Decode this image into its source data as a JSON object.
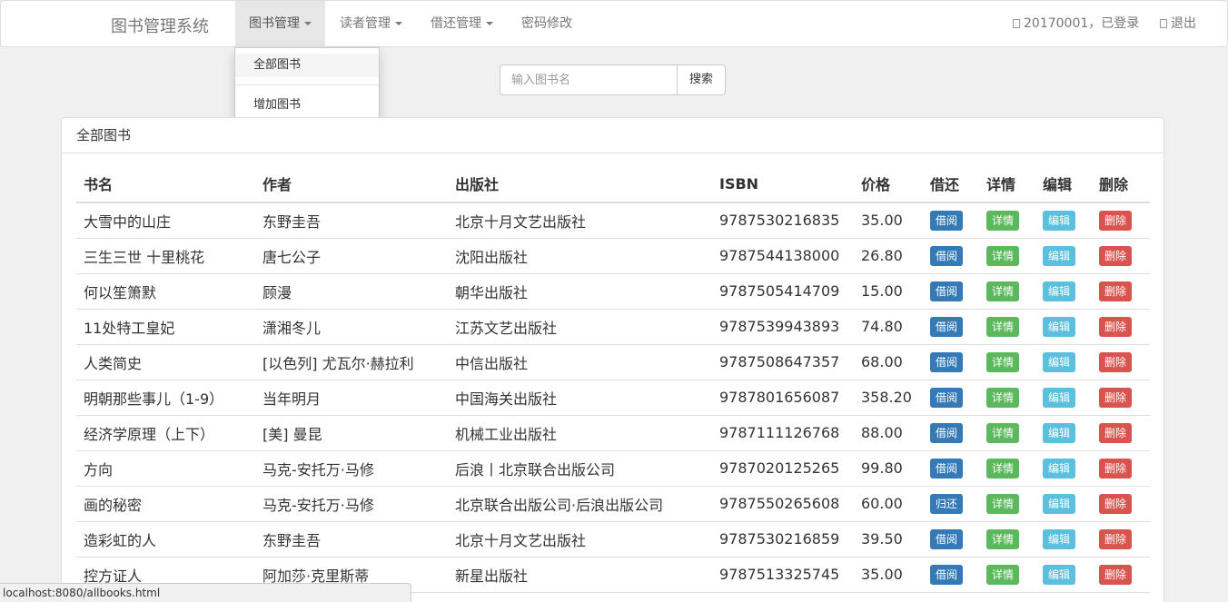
{
  "navbar": {
    "brand": "图书管理系统",
    "menu": {
      "books": "图书管理",
      "readers": "读者管理",
      "borrow": "借还管理",
      "password": "密码修改"
    },
    "user_status": "20170001，已登录",
    "logout": "退出"
  },
  "dropdown": {
    "all_books": "全部图书",
    "add_book": "增加图书"
  },
  "search": {
    "placeholder": "输入图书名",
    "button": "搜索"
  },
  "panel": {
    "title": "全部图书"
  },
  "table": {
    "headers": [
      "书名",
      "作者",
      "出版社",
      "ISBN",
      "价格",
      "借还",
      "详情",
      "编辑",
      "删除"
    ],
    "rows": [
      {
        "title": "大雪中的山庄",
        "author": "东野圭吾",
        "publisher": "北京十月文艺出版社",
        "isbn": "9787530216835",
        "price": "35.00",
        "action": "借阅"
      },
      {
        "title": "三生三世 十里桃花",
        "author": "唐七公子",
        "publisher": "沈阳出版社",
        "isbn": "9787544138000",
        "price": "26.80",
        "action": "借阅"
      },
      {
        "title": "何以笙箫默",
        "author": "顾漫",
        "publisher": "朝华出版社",
        "isbn": "9787505414709",
        "price": "15.00",
        "action": "借阅"
      },
      {
        "title": "11处特工皇妃",
        "author": "潇湘冬儿",
        "publisher": "江苏文艺出版社",
        "isbn": "9787539943893",
        "price": "74.80",
        "action": "借阅"
      },
      {
        "title": "人类简史",
        "author": "[以色列] 尤瓦尔·赫拉利",
        "publisher": "中信出版社",
        "isbn": "9787508647357",
        "price": "68.00",
        "action": "借阅"
      },
      {
        "title": "明朝那些事儿（1-9）",
        "author": "当年明月",
        "publisher": "中国海关出版社",
        "isbn": "9787801656087",
        "price": "358.20",
        "action": "借阅"
      },
      {
        "title": "经济学原理（上下）",
        "author": "[美] 曼昆",
        "publisher": "机械工业出版社",
        "isbn": "9787111126768",
        "price": "88.00",
        "action": "借阅"
      },
      {
        "title": "方向",
        "author": "马克-安托万·马修",
        "publisher": "后浪丨北京联合出版公司",
        "isbn": "9787020125265",
        "price": "99.80",
        "action": "借阅"
      },
      {
        "title": "画的秘密",
        "author": "马克-安托万·马修",
        "publisher": "北京联合出版公司·后浪出版公司",
        "isbn": "9787550265608",
        "price": "60.00",
        "action": "归还"
      },
      {
        "title": "造彩虹的人",
        "author": "东野圭吾",
        "publisher": "北京十月文艺出版社",
        "isbn": "9787530216859",
        "price": "39.50",
        "action": "借阅"
      },
      {
        "title": "控方证人",
        "author": "阿加莎·克里斯蒂",
        "publisher": "新星出版社",
        "isbn": "9787513325745",
        "price": "35.00",
        "action": "借阅"
      }
    ],
    "detail_label": "详情",
    "edit_label": "编辑",
    "delete_label": "删除"
  },
  "status_bar": "localhost:8080/allbooks.html",
  "colors": {
    "borrow": "#337ab7",
    "detail": "#5cb85c",
    "edit": "#5bc0de",
    "delete": "#d9534f"
  }
}
